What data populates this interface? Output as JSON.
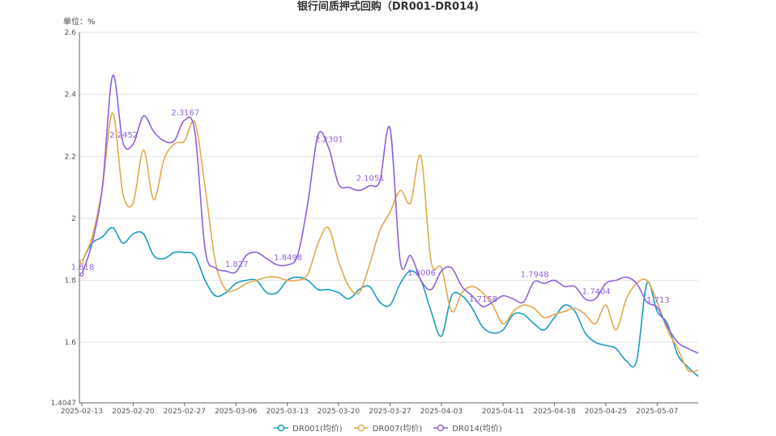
{
  "chart_data": {
    "type": "line",
    "title": "银行间质押式回购（DR001-DR014)",
    "unit_label": "单位：%",
    "ylim": [
      1.4047,
      2.6
    ],
    "y_ticks": [
      "1.4047",
      "1.6",
      "1.8",
      "2",
      "2.2",
      "2.4",
      "2.6"
    ],
    "y_tick_values": [
      1.4047,
      1.6,
      1.8,
      2.0,
      2.2,
      2.4,
      2.6
    ],
    "grid": true,
    "legend_position": "bottom-center",
    "x_tick_labels": [
      "2025-02-13",
      "2025-02-20",
      "2025-02-27",
      "2025-03-06",
      "2025-03-13",
      "2025-03-20",
      "2025-03-27",
      "2025-04-03",
      "2025-04-11",
      "2025-04-18",
      "2025-04-25",
      "2025-05-07"
    ],
    "x_tick_index": [
      0,
      5,
      10,
      15,
      20,
      25,
      30,
      35,
      41,
      46,
      51,
      56
    ],
    "n_points": 61,
    "series": [
      {
        "name": "DR001(均价)",
        "color": "#1a9bc0",
        "values": [
          1.86,
          1.92,
          1.94,
          1.97,
          1.92,
          1.95,
          1.95,
          1.88,
          1.87,
          1.89,
          1.89,
          1.88,
          1.8,
          1.75,
          1.76,
          1.79,
          1.8,
          1.8,
          1.76,
          1.76,
          1.8,
          1.81,
          1.8,
          1.77,
          1.77,
          1.76,
          1.74,
          1.77,
          1.78,
          1.73,
          1.72,
          1.79,
          1.83,
          1.8,
          1.7,
          1.62,
          1.75,
          1.75,
          1.71,
          1.65,
          1.63,
          1.64,
          1.69,
          1.69,
          1.66,
          1.64,
          1.68,
          1.72,
          1.7,
          1.63,
          1.6,
          1.59,
          1.58,
          1.54,
          1.54,
          1.79,
          1.7,
          1.66,
          1.56,
          1.52,
          1.49
        ]
      },
      {
        "name": "DR007(均价)",
        "color": "#e3a94b",
        "values": [
          1.86,
          1.94,
          2.1,
          2.34,
          2.08,
          2.05,
          2.22,
          2.06,
          2.19,
          2.24,
          2.25,
          2.31,
          2.1,
          1.86,
          1.77,
          1.77,
          1.79,
          1.8,
          1.81,
          1.81,
          1.8,
          1.8,
          1.82,
          1.92,
          1.97,
          1.86,
          1.78,
          1.76,
          1.85,
          1.96,
          2.02,
          2.09,
          2.05,
          2.2,
          1.86,
          1.84,
          1.7,
          1.76,
          1.78,
          1.76,
          1.72,
          1.66,
          1.7,
          1.72,
          1.71,
          1.68,
          1.69,
          1.7,
          1.71,
          1.69,
          1.66,
          1.72,
          1.64,
          1.74,
          1.79,
          1.8,
          1.73,
          1.64,
          1.58,
          1.51,
          1.51
        ]
      },
      {
        "name": "DR014(均价)",
        "color": "#8f61d9",
        "values": [
          1.8188,
          1.92,
          2.1,
          2.46,
          2.2452,
          2.24,
          2.33,
          2.28,
          2.25,
          2.25,
          2.3167,
          2.28,
          1.9,
          1.84,
          1.83,
          1.827,
          1.88,
          1.89,
          1.87,
          1.85,
          1.8498,
          1.88,
          2.05,
          2.27,
          2.2301,
          2.11,
          2.1,
          2.09,
          2.1051,
          2.12,
          2.29,
          1.86,
          1.88,
          1.8006,
          1.77,
          1.83,
          1.84,
          1.78,
          1.75,
          1.7158,
          1.73,
          1.75,
          1.74,
          1.73,
          1.7948,
          1.79,
          1.8,
          1.78,
          1.78,
          1.74,
          1.7404,
          1.79,
          1.8,
          1.81,
          1.79,
          1.73,
          1.713,
          1.65,
          1.6,
          1.58,
          1.565
        ]
      }
    ],
    "annotations": [
      {
        "series": 2,
        "index": 0,
        "text": "1.818"
      },
      {
        "series": 2,
        "index": 4,
        "text": "2.2452"
      },
      {
        "series": 2,
        "index": 10,
        "text": "2.3167"
      },
      {
        "series": 2,
        "index": 15,
        "text": "1.827"
      },
      {
        "series": 2,
        "index": 20,
        "text": "1.8498"
      },
      {
        "series": 2,
        "index": 24,
        "text": "2.2301"
      },
      {
        "series": 2,
        "index": 28,
        "text": "2.1051"
      },
      {
        "series": 2,
        "index": 33,
        "text": "1.8006"
      },
      {
        "series": 2,
        "index": 39,
        "text": "1.7158"
      },
      {
        "series": 2,
        "index": 44,
        "text": "1.7948"
      },
      {
        "series": 2,
        "index": 50,
        "text": "1.7404"
      },
      {
        "series": 2,
        "index": 56,
        "text": "1.713"
      }
    ]
  }
}
